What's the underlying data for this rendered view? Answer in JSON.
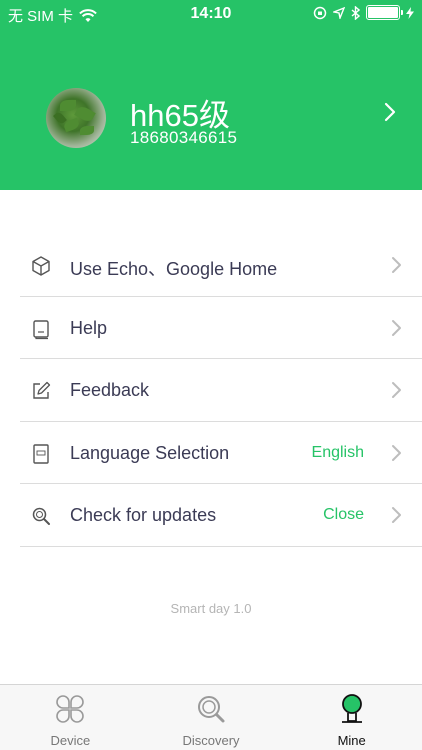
{
  "status_bar": {
    "carrier": "无 SIM 卡",
    "time": "14:10",
    "battery_level": 1.0
  },
  "profile": {
    "username": "hh65级",
    "phone": "18680346615"
  },
  "menu": [
    {
      "icon": "cube-icon",
      "label": "Use Echo、Google Home",
      "value": ""
    },
    {
      "icon": "book-icon",
      "label": "Help",
      "value": ""
    },
    {
      "icon": "edit-icon",
      "label": "Feedback",
      "value": ""
    },
    {
      "icon": "abc-book-icon",
      "label": "Language Selection",
      "value": "English"
    },
    {
      "icon": "search-icon",
      "label": "Check for updates",
      "value": "Close"
    }
  ],
  "version": "Smart day 1.0",
  "tabbar": [
    {
      "icon": "clover-icon",
      "label": "Device",
      "active": false
    },
    {
      "icon": "magnifier-icon",
      "label": "Discovery",
      "active": false
    },
    {
      "icon": "person-icon",
      "label": "Mine",
      "active": true
    }
  ],
  "colors": {
    "accent": "#26c367"
  }
}
